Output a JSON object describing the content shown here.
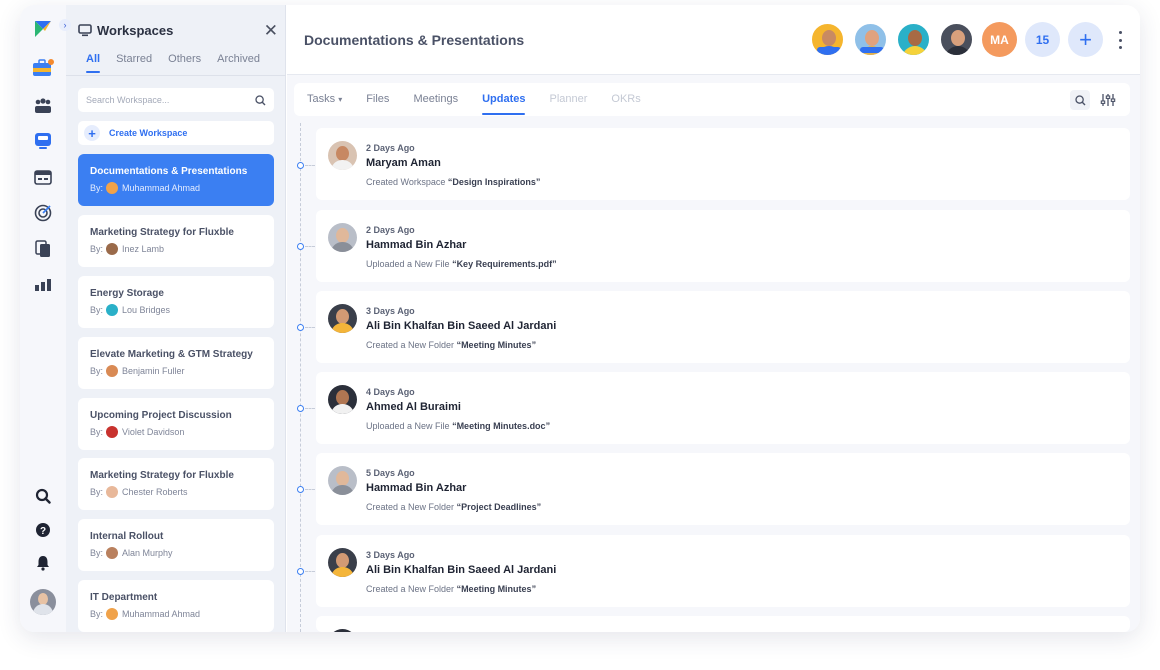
{
  "rail": {
    "toggle_icon": "chevron-right-icon",
    "top_icons": [
      "brand-logo",
      "briefcase-icon",
      "team-icon",
      "board-icon",
      "calendar-icon",
      "target-icon",
      "documents-icon",
      "analytics-icon"
    ],
    "bottom_icons": [
      "search-icon",
      "help-icon",
      "bell-icon",
      "profile-avatar"
    ]
  },
  "workspaces": {
    "title": "Workspaces",
    "tabs": [
      "All",
      "Starred",
      "Others",
      "Archived"
    ],
    "active_tab": "All",
    "search_placeholder": "Search Workspace...",
    "create_label": "Create Workspace",
    "by_prefix": "By:",
    "items": [
      {
        "name": "Documentations & Presentations",
        "owner": "Muhammad Ahmad",
        "active": true
      },
      {
        "name": "Marketing Strategy for Fluxble",
        "owner": "Inez Lamb"
      },
      {
        "name": "Energy Storage",
        "owner": "Lou Bridges"
      },
      {
        "name": "Elevate Marketing & GTM Strategy",
        "owner": "Benjamin Fuller"
      },
      {
        "name": "Upcoming Project Discussion",
        "owner": "Violet Davidson"
      },
      {
        "name": "Marketing Strategy for Fluxble",
        "owner": "Chester Roberts"
      },
      {
        "name": "Internal Rollout",
        "owner": "Alan Murphy"
      },
      {
        "name": "IT Department",
        "owner": "Muhammad Ahmad"
      }
    ]
  },
  "header": {
    "title": "Documentations & Presentations",
    "initials": "MA",
    "member_count": "15"
  },
  "tabs": {
    "items": [
      "Tasks",
      "Files",
      "Meetings",
      "Updates",
      "Planner",
      "OKRs"
    ],
    "active": "Updates",
    "disabled": [
      "Planner",
      "OKRs"
    ],
    "tasks_dropdown": "▾"
  },
  "updates": [
    {
      "when": "2 Days Ago",
      "who": "Maryam Aman",
      "action": "Created Workspace",
      "target": "“Design Inspirations”"
    },
    {
      "when": "2 Days Ago",
      "who": "Hammad Bin Azhar",
      "action": "Uploaded a New File",
      "target": "“Key Requirements.pdf”"
    },
    {
      "when": "3 Days Ago",
      "who": "Ali Bin Khalfan Bin Saeed Al Jardani",
      "action": "Created a New Folder",
      "target": "“Meeting Minutes”"
    },
    {
      "when": "4 Days Ago",
      "who": "Ahmed Al Buraimi",
      "action": "Uploaded a New File",
      "target": "“Meeting Minutes.doc”"
    },
    {
      "when": "5 Days Ago",
      "who": "Hammad Bin Azhar",
      "action": "Created a New Folder",
      "target": "“Project Deadlines”"
    },
    {
      "when": "3 Days Ago",
      "who": "Ali Bin Khalfan Bin Saeed Al Jardani",
      "action": "Created a New Folder",
      "target": "“Meeting Minutes”"
    }
  ],
  "colors": {
    "accent": "#2f6ff0",
    "active_card": "#3b7ff2",
    "initials_bg": "#f49a5e"
  }
}
